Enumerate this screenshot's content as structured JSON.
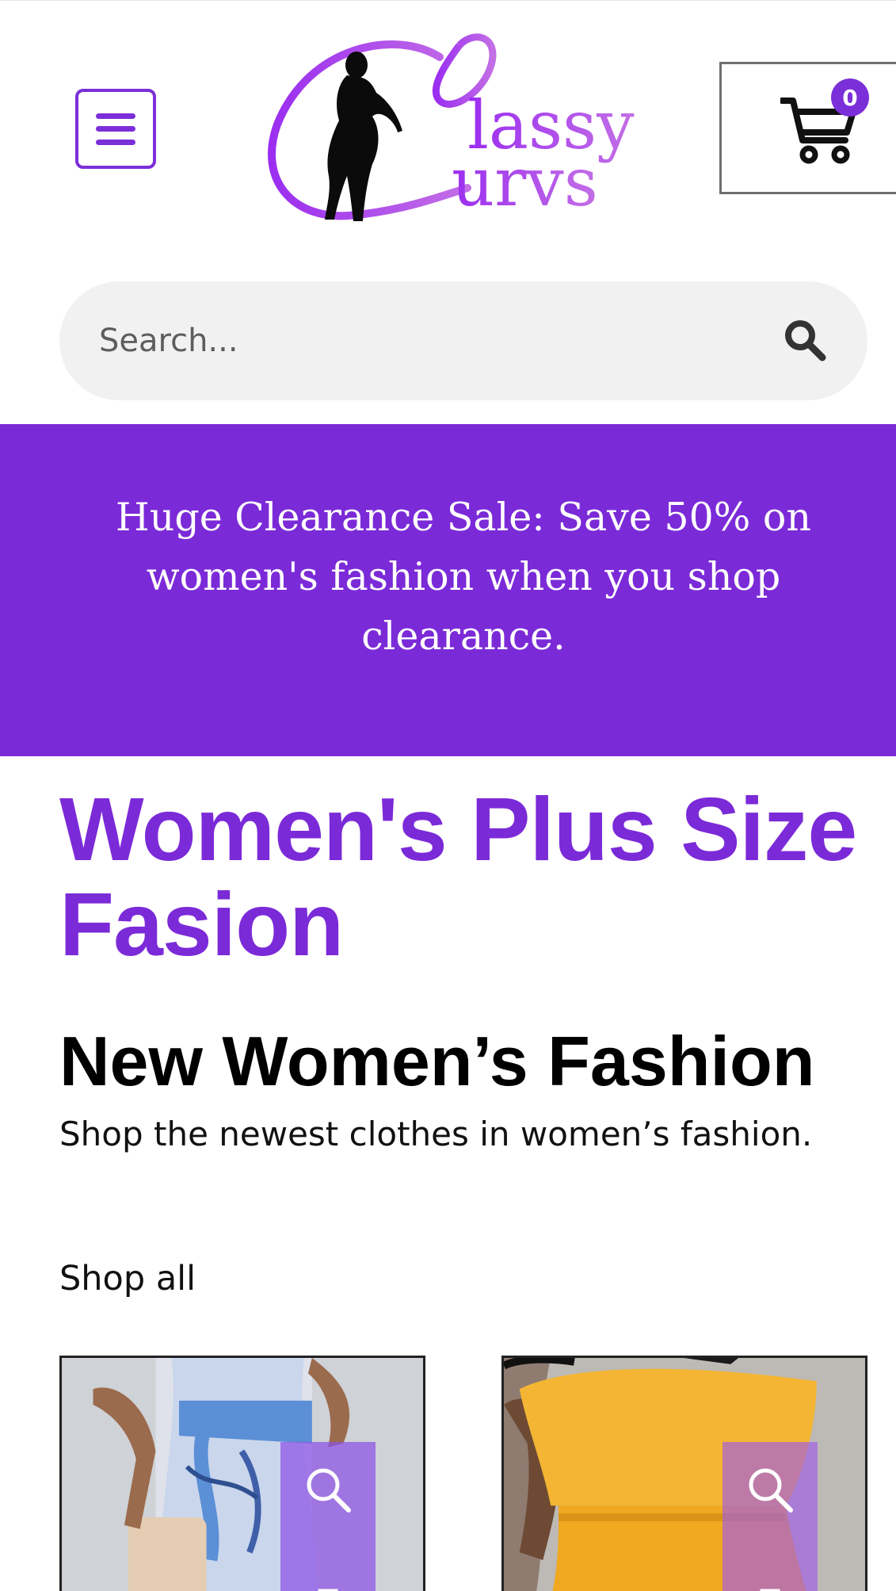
{
  "header": {
    "menu_label": "Menu",
    "logo_text_top": "lassy",
    "logo_text_bottom": "urvs",
    "cart_count": "0"
  },
  "search": {
    "placeholder": "Search..."
  },
  "banner": {
    "text": "Huge Clearance Sale: Save 50% on women's fashion when you shop clearance."
  },
  "main": {
    "page_title": "Women's Plus Size Fasion",
    "section_title": "New Women’s Fashion",
    "section_subtitle": "Shop the newest clothes in women’s fashion.",
    "shop_all": "Shop all"
  },
  "products": [
    {
      "icon_quick_view": "search-icon",
      "icon_cart": "shopping-bag-icon"
    },
    {
      "icon_quick_view": "search-icon",
      "icon_cart": "shopping-bag-icon"
    }
  ],
  "colors": {
    "accent": "#7b2ad8",
    "search_bg": "#f1f1f1",
    "text": "#000000"
  }
}
